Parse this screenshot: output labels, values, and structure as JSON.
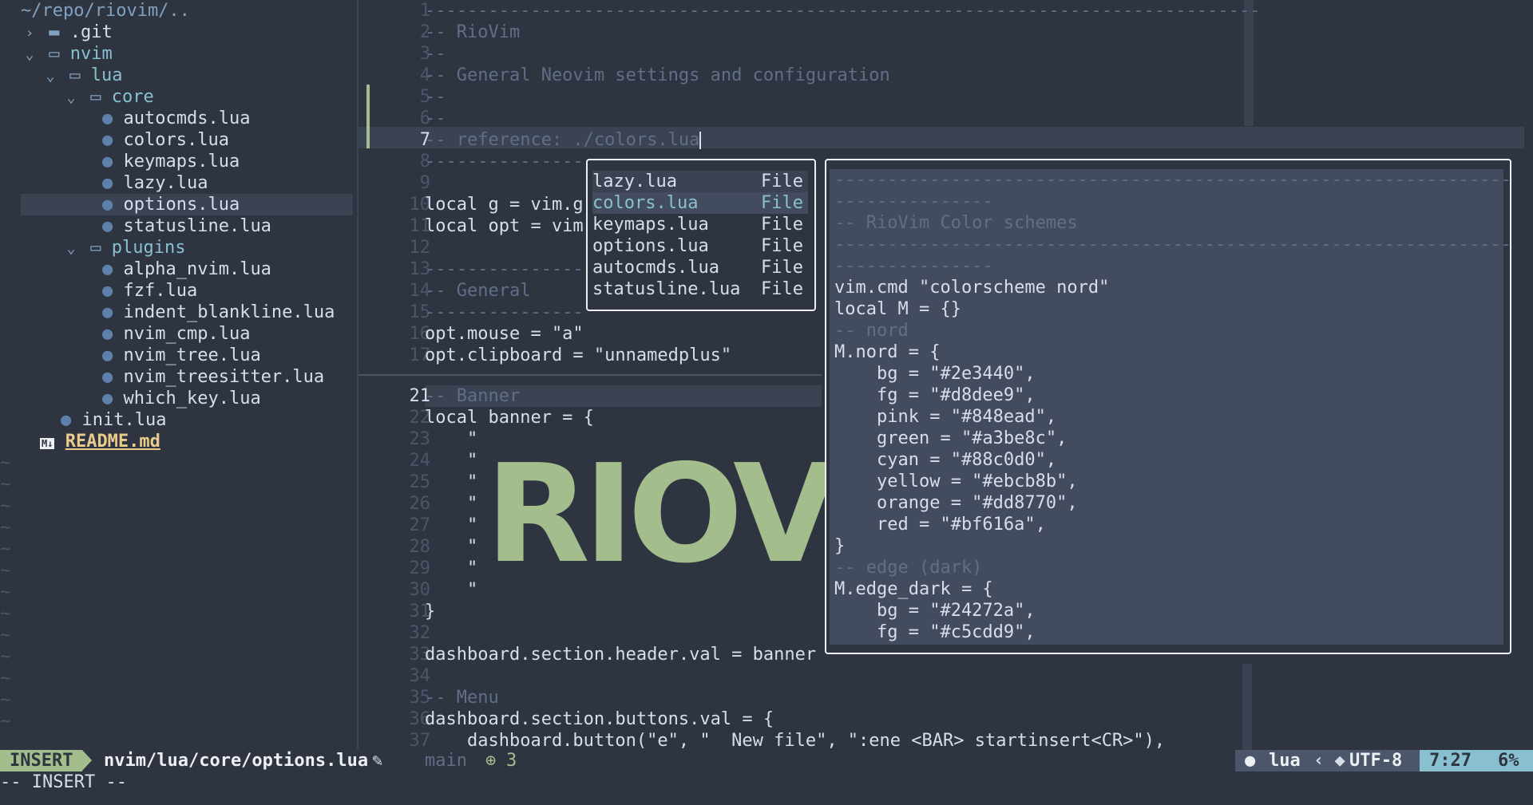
{
  "tree": {
    "root_path": "~/repo/riovim/..",
    "git": ".git",
    "nvim": "nvim",
    "lua": "lua",
    "core": "core",
    "core_files": [
      "autocmds.lua",
      "colors.lua",
      "keymaps.lua",
      "lazy.lua",
      "options.lua",
      "statusline.lua"
    ],
    "plugins": "plugins",
    "plugin_files": [
      "alpha_nvim.lua",
      "fzf.lua",
      "indent_blankline.lua",
      "nvim_cmp.lua",
      "nvim_tree.lua",
      "nvim_treesitter.lua",
      "which_key.lua"
    ],
    "init": "init.lua",
    "readme_badge": "M↓",
    "readme": "README.md"
  },
  "editor": {
    "top_lines": [
      {
        "n": "1",
        "t": "-------------------------------------------------------------------------------"
      },
      {
        "n": "2",
        "t": "-- RioVim"
      },
      {
        "n": "3",
        "t": "--"
      },
      {
        "n": "4",
        "t": "-- General Neovim settings and configuration"
      },
      {
        "n": "5",
        "t": "--"
      },
      {
        "n": "6",
        "t": "--"
      },
      {
        "n": "7",
        "t": "-- reference: ./colors.lua"
      },
      {
        "n": "8",
        "t": "---------------"
      },
      {
        "n": "9",
        "t": ""
      },
      {
        "n": "10",
        "t": "local g = vim.g"
      },
      {
        "n": "11",
        "t": "local opt = vim"
      },
      {
        "n": "12",
        "t": ""
      },
      {
        "n": "13",
        "t": "---------------"
      },
      {
        "n": "14",
        "t": "-- General"
      },
      {
        "n": "15",
        "t": "---------------"
      },
      {
        "n": "16",
        "t": "opt.mouse = \"a\""
      },
      {
        "n": "17",
        "t": "opt.clipboard = \"unnamedplus\""
      }
    ],
    "bottom_lines": [
      {
        "n": "21",
        "t": "-- Banner"
      },
      {
        "n": "22",
        "t": "local banner = {"
      },
      {
        "n": "23",
        "t": "    \""
      },
      {
        "n": "24",
        "t": "    \""
      },
      {
        "n": "25",
        "t": "    \""
      },
      {
        "n": "26",
        "t": "    \""
      },
      {
        "n": "27",
        "t": "    \""
      },
      {
        "n": "28",
        "t": "    \""
      },
      {
        "n": "29",
        "t": "    \""
      },
      {
        "n": "30",
        "t": "    \""
      },
      {
        "n": "31",
        "t": "}"
      },
      {
        "n": "32",
        "t": ""
      },
      {
        "n": "33",
        "t": "dashboard.section.header.val = banner"
      },
      {
        "n": "34",
        "t": ""
      },
      {
        "n": "35",
        "t": "-- Menu"
      },
      {
        "n": "36",
        "t": "dashboard.section.buttons.val = {"
      },
      {
        "n": "37",
        "t": "    dashboard.button(\"e\", \"  New file\", \":ene <BAR> startinsert<CR>\"),"
      }
    ],
    "banner_art": "RIOVI"
  },
  "completion": {
    "items": [
      {
        "label": "lazy.lua",
        "kind": "File"
      },
      {
        "label": "colors.lua",
        "kind": "File"
      },
      {
        "label": "keymaps.lua",
        "kind": "File"
      },
      {
        "label": "options.lua",
        "kind": "File"
      },
      {
        "label": "autocmds.lua",
        "kind": "File"
      },
      {
        "label": "statusline.lua",
        "kind": "File"
      }
    ]
  },
  "preview": {
    "lines": [
      "-------------------------------------------------------------------------------",
      "---------------",
      "-- RioVim Color schemes",
      "-------------------------------------------------------------------------------",
      "---------------",
      "vim.cmd \"colorscheme nord\"",
      "local M = {}",
      "-- nord",
      "M.nord = {",
      "    bg = \"#2e3440\",",
      "    fg = \"#d8dee9\",",
      "    pink = \"#848ead\",",
      "    green = \"#a3be8c\",",
      "    cyan = \"#88c0d0\",",
      "    yellow = \"#ebcb8b\",",
      "    orange = \"#dd8770\",",
      "    red = \"#bf616a\",",
      "}",
      "-- edge (dark)",
      "M.edge_dark = {",
      "    bg = \"#24272a\",",
      "    fg = \"#c5cdd9\","
    ]
  },
  "status": {
    "mode": "INSERT",
    "file": "nvim/lua/core/options.lua",
    "edit_icon": "✎",
    "branch_icon": "",
    "branch": "main",
    "diff_icon": "⊕",
    "diff_count": "3",
    "filetype": "lua",
    "encoding": "UTF-8",
    "position": "7:27",
    "percent": "6%",
    "cmdline": "-- INSERT --"
  },
  "colors": {
    "bg": "#2e3440",
    "accent_green": "#a3be8c",
    "accent_cyan": "#88c0d0",
    "comment": "#616e88"
  }
}
